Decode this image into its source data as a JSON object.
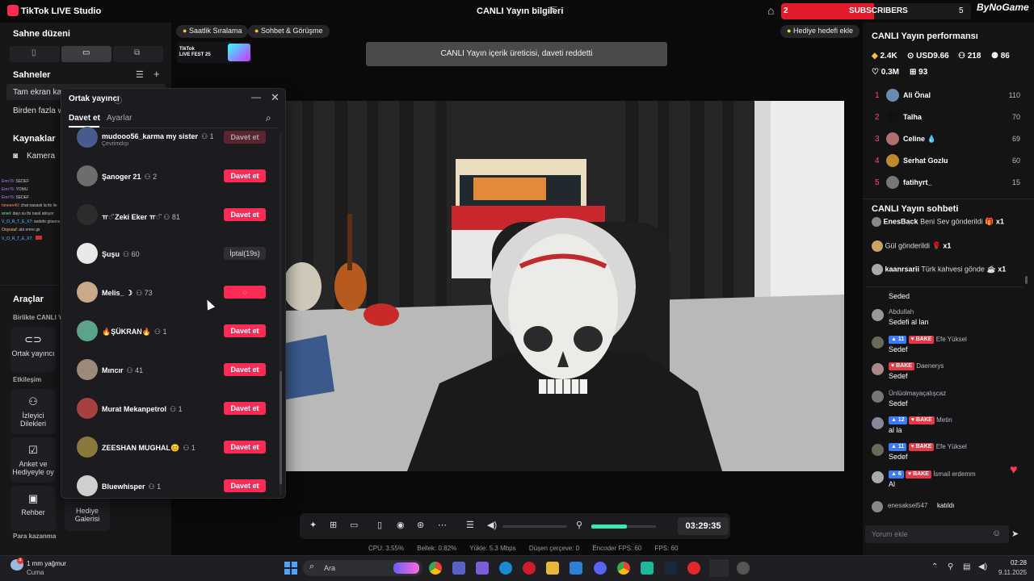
{
  "titlebar": {
    "app_name": "TikTok LIVE Studio",
    "center_title": "CANLI Yayın bilgileri",
    "subs_left": "2",
    "subs_label": "SUBSCRIBERS",
    "subs_right": "5",
    "brand": "ByNoGame"
  },
  "left": {
    "scene_layout_title": "Sahne düzeni",
    "scenes_title": "Sahneler",
    "scenes": [
      "Tam ekran kam",
      "Birden fazla w"
    ],
    "sources_title": "Kaynaklar",
    "source_camera": "Kamera",
    "mini_chat": [
      {
        "user": "Emr76",
        "text": "SEDEF"
      },
      {
        "user": "Emr76",
        "text": "YOMU"
      },
      {
        "user": "Emr76",
        "text": "SEDEF"
      },
      {
        "user": "hmeen40",
        "text": "chat navasti la tts ile"
      },
      {
        "user": "arvel",
        "text": "dayı su tts nasıl atılıyor"
      },
      {
        "user": "V_O_R_T_E_X7",
        "text": "sedefe gitsene la"
      },
      {
        "user": "Ooyusuf",
        "text": "abi emre gir"
      },
      {
        "user": "V_O_R_T_E_X7",
        "text": ""
      }
    ],
    "tools_title": "Araçlar",
    "together_title": "Birlikte CANLI Y",
    "cohost_btn": "Ortak yayıncı",
    "interaction_title": "Etkileşim",
    "viewer_req_btn": "İzleyici Dilekleri",
    "poll_btn": "Anket ve Hediyeyle oy",
    "guide_btn": "Rehber",
    "gift_gallery_btn": "Hediye Galerisi",
    "earn_title": "Para kazanma"
  },
  "preview": {
    "pill_ranking": "Saatlik Sıralama",
    "pill_chat": "Sohbet & Görüşme",
    "pill_gift_goal": "Hediye hedefi ekle",
    "fest_line1": "TikTok",
    "fest_line2": "LIVE FEST 25",
    "notice": "CANLI Yayın içerik üreticisi, daveti reddetti",
    "timer": "03:29:35",
    "mic_level": 0.55,
    "stats": {
      "cpu": "CPU: 3.55%",
      "memory": "Bellek: 0.82%",
      "upload": "Yükle: 5.3 Mbps",
      "dropped": "Düşen çerçeve: 0",
      "encoder_fps": "Encoder FPS: 60",
      "fps": "FPS: 60"
    }
  },
  "dialog": {
    "title": "Ortak yayıncı",
    "tab_invite": "Davet et",
    "tab_settings": "Ayarlar",
    "hosts": [
      {
        "name": "mudooo56_karma my sister",
        "count": "1",
        "sub": "Çevrimdışı",
        "button": "Davet et",
        "state": "disabled",
        "color": "#4a5a8a"
      },
      {
        "name": "Şanoger 21",
        "count": "2",
        "sub": "",
        "button": "Davet et",
        "state": "active",
        "color": "#6d6d6d"
      },
      {
        "name": "ㅠ◌̈ Zeki Eker ㅠ◌̈",
        "count": "81",
        "sub": "",
        "button": "Davet et",
        "state": "active",
        "color": "#2d2d2d"
      },
      {
        "name": "Şuşu",
        "count": "60",
        "sub": "",
        "button": "İptal(19s)",
        "state": "cancel",
        "color": "#e8e8e8"
      },
      {
        "name": "Melis_ ☽",
        "count": "73",
        "sub": "",
        "button": "",
        "state": "loading",
        "color": "#c9a98a"
      },
      {
        "name": "🔥ŞÜKRAN🔥",
        "count": "1",
        "sub": "",
        "button": "Davet et",
        "state": "active",
        "color": "#5aa58a"
      },
      {
        "name": "Mıncır",
        "count": "41",
        "sub": "",
        "button": "Davet et",
        "state": "active",
        "color": "#9b8a7a"
      },
      {
        "name": "Murat Mekanpetrol",
        "count": "1",
        "sub": "",
        "button": "Davet et",
        "state": "active",
        "color": "#a84040"
      },
      {
        "name": "ZEESHAN MUGHAL😊",
        "count": "1",
        "sub": "",
        "button": "Davet et",
        "state": "active",
        "color": "#8a7a3a"
      },
      {
        "name": "Bluewhisper",
        "count": "1",
        "sub": "",
        "button": "Davet et",
        "state": "active",
        "color": "#cfcfcf"
      }
    ]
  },
  "right": {
    "perf_title": "CANLI Yayın performansı",
    "stat_diamonds": "2.4K",
    "stat_usd": "USD9.66",
    "stat_viewers": "218",
    "stat_followers": "86",
    "stat_likes": "0.3M",
    "stat_gifters": "93",
    "ranking": [
      {
        "rank": "1",
        "name": "Ali Önal",
        "score": "110",
        "color": "#6a8ab0"
      },
      {
        "rank": "2",
        "name": "Talha",
        "score": "70",
        "color": "#111111"
      },
      {
        "rank": "3",
        "name": "Celine 💧",
        "score": "69",
        "color": "#b07070"
      },
      {
        "rank": "4",
        "name": "Serhat Gozlu",
        "score": "60",
        "color": "#c08a2a"
      },
      {
        "rank": "5",
        "name": "fatihyrt_",
        "score": "15",
        "color": "#777777"
      }
    ],
    "chat_title": "CANLI Yayın sohbeti",
    "gifts": [
      {
        "user": "EnesBack",
        "action": "Beni Sev gönderildi",
        "gift": "🎁",
        "mult": "x1"
      },
      {
        "user": "",
        "action": "Gül gönderildi",
        "gift": "🌹",
        "mult": "x1"
      },
      {
        "user": "kaanrsarii",
        "action": "Türk kahvesi gönde",
        "gift": "☕",
        "mult": "x1"
      }
    ],
    "comments": [
      {
        "name": "",
        "lvl": "",
        "tag": "",
        "text": "Seded"
      },
      {
        "name": "Abdullah",
        "lvl": "",
        "tag": "",
        "text": "Sedefi al lan"
      },
      {
        "name": "Efe Yüksel",
        "lvl": "11",
        "tag": "BAKE",
        "text": "Sedef"
      },
      {
        "name": "Daenerys",
        "lvl": "",
        "tag": "BAKE",
        "text": "Sedef"
      },
      {
        "name": "Ünlüolmayaçalışcaz",
        "lvl": "",
        "tag": "",
        "text": "Sedef"
      },
      {
        "name": "Metin",
        "lvl": "12",
        "tag": "BAKE",
        "text": "al la"
      },
      {
        "name": "Efe Yüksel",
        "lvl": "11",
        "tag": "BAKE",
        "text": "Sedef"
      },
      {
        "name": "İsmail erdemm",
        "lvl": "6",
        "tag": "BAKE",
        "text": "Al"
      }
    ],
    "join_user": "enesaksel547",
    "join_text": "katıldı",
    "comment_placeholder": "Yorum ekle"
  },
  "taskbar": {
    "weather_badge": "4",
    "weather_line1": "1 mm yağmur",
    "weather_line2": "Cuma",
    "search_placeholder": "Ara",
    "time": "02:28",
    "date": "9.11.2025"
  },
  "colors": {
    "accent": "#fe2c55",
    "mic_level": "#3ee6b0",
    "rank_number": "#fe4c6a"
  }
}
